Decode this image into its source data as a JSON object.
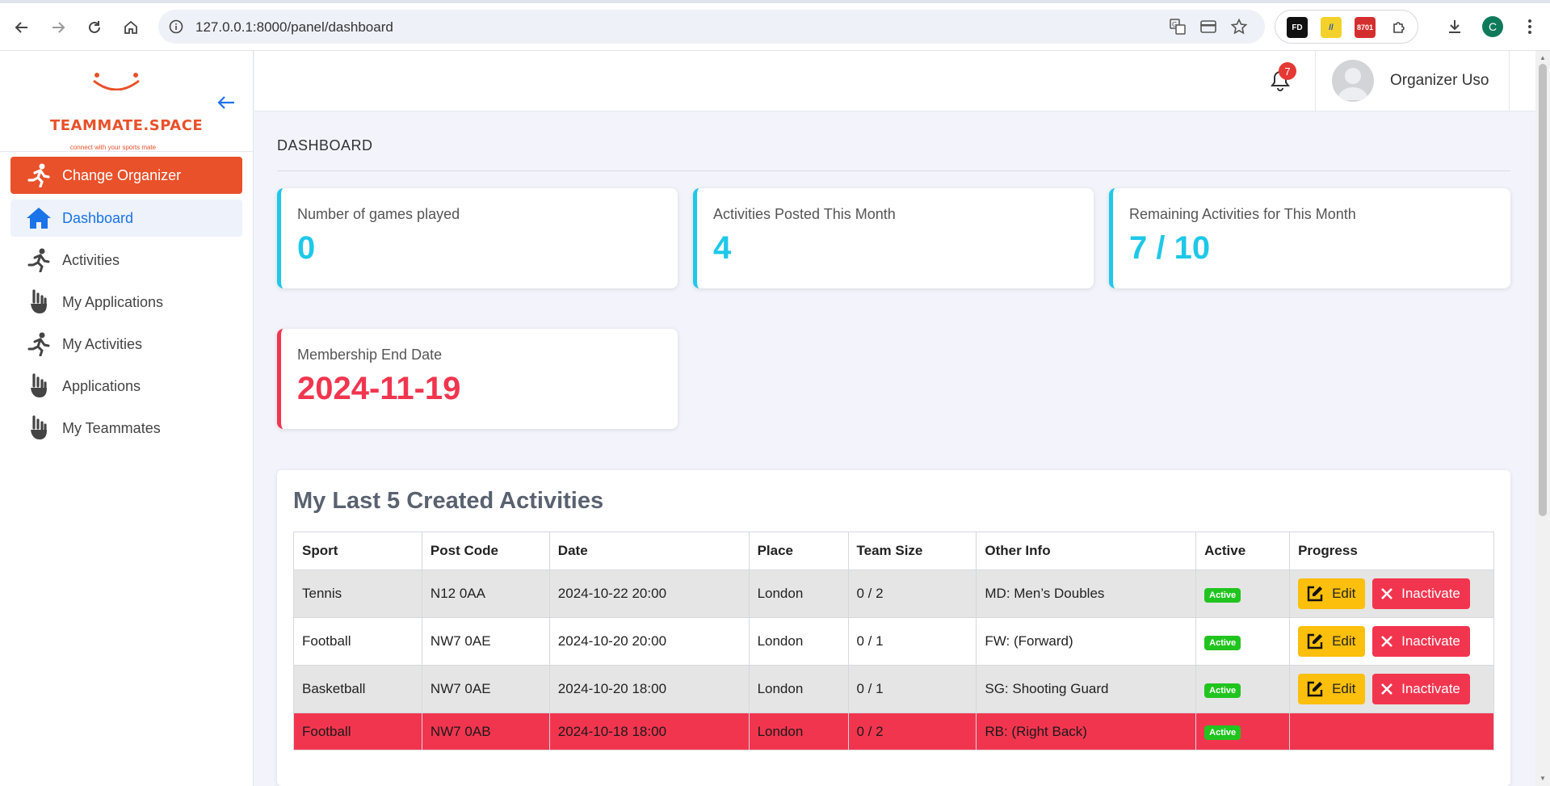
{
  "browser": {
    "url": "127.0.0.1:8000/panel/dashboard",
    "profile_initial": "C",
    "ext_badge": "8701"
  },
  "sidebar": {
    "brand": "TEAMMATE.SPACE",
    "tagline": "connect with your sports mate",
    "items": [
      {
        "label": "Change Organizer",
        "icon": "runner-icon"
      },
      {
        "label": "Dashboard",
        "icon": "home-icon"
      },
      {
        "label": "Activities",
        "icon": "runner-icon"
      },
      {
        "label": "My Applications",
        "icon": "hand-icon"
      },
      {
        "label": "My Activities",
        "icon": "runner-icon"
      },
      {
        "label": "Applications",
        "icon": "hand-icon"
      },
      {
        "label": "My Teammates",
        "icon": "hand-icon"
      }
    ]
  },
  "header": {
    "notification_count": "7",
    "username": "Organizer Uso"
  },
  "page_title": "DASHBOARD",
  "stats": [
    {
      "label": "Number of games played",
      "value": "0"
    },
    {
      "label": "Activities Posted This Month",
      "value": "4"
    },
    {
      "label": "Remaining Activities for This Month",
      "value": "7 / 10"
    },
    {
      "label": "Membership End Date",
      "value": "2024-11-19"
    }
  ],
  "table": {
    "title": "My Last 5 Created Activities",
    "columns": [
      "Sport",
      "Post Code",
      "Date",
      "Place",
      "Team Size",
      "Other Info",
      "Active",
      "Progress"
    ],
    "rows": [
      {
        "sport": "Tennis",
        "post_code": "N12 0AA",
        "date": "2024-10-22 20:00",
        "place": "London",
        "team_size": "0 / 2",
        "other_info": "MD: Men’s Doubles",
        "active": "Active"
      },
      {
        "sport": "Football",
        "post_code": "NW7 0AE",
        "date": "2024-10-20 20:00",
        "place": "London",
        "team_size": "0 / 1",
        "other_info": "FW: (Forward)",
        "active": "Active"
      },
      {
        "sport": "Basketball",
        "post_code": "NW7 0AE",
        "date": "2024-10-20 18:00",
        "place": "London",
        "team_size": "0 / 1",
        "other_info": "SG: Shooting Guard",
        "active": "Active"
      },
      {
        "sport": "Football",
        "post_code": "NW7 0AB",
        "date": "2024-10-18 18:00",
        "place": "London",
        "team_size": "0 / 2",
        "other_info": "RB: (Right Back)",
        "active": "Active"
      }
    ],
    "edit_label": "Edit",
    "inactivate_label": "Inactivate"
  },
  "colors": {
    "brand_orange": "#e8512a",
    "stat_cyan": "#1ec8e8",
    "alert_red": "#f2354f",
    "edit_yellow": "#fbbf0c",
    "active_green": "#21c41f"
  }
}
